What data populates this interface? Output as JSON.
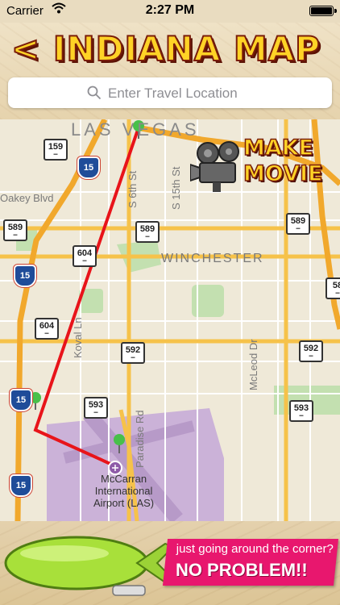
{
  "status_bar": {
    "carrier": "Carrier",
    "time": "2:27 PM"
  },
  "header": {
    "title": "< INDIANA MAP",
    "search": {
      "placeholder": "Enter Travel Location",
      "value": ""
    }
  },
  "map": {
    "city_label": "LAS VEGAS",
    "area_label": "WINCHESTER",
    "airport_label_line1": "McCarran",
    "airport_label_line2": "International",
    "airport_label_line3": "Airport (LAS)",
    "streets": {
      "oakey": "Oakey Blvd",
      "s6th": "S 6th St",
      "s15th": "S 15th St",
      "koval": "Koval Ln",
      "paradise": "Paradise Rd",
      "mcleod": "McLeod Dr"
    },
    "route_shields": [
      "159",
      "589",
      "589",
      "589",
      "604",
      "604",
      "592",
      "592",
      "593",
      "593",
      "58"
    ],
    "interstate_shields": [
      "15",
      "15",
      "15",
      "15"
    ],
    "make_movie_line1": "MAKE",
    "make_movie_line2": "MOVIE",
    "colors": {
      "route_line": "#e8141a",
      "pin": "#48c04a",
      "interstate": "#f6c24a",
      "park": "#c3e0b0",
      "airport": "#cbb2d8"
    }
  },
  "banner": {
    "line1": "just going around the corner?",
    "line2": "NO PROBLEM!!"
  }
}
